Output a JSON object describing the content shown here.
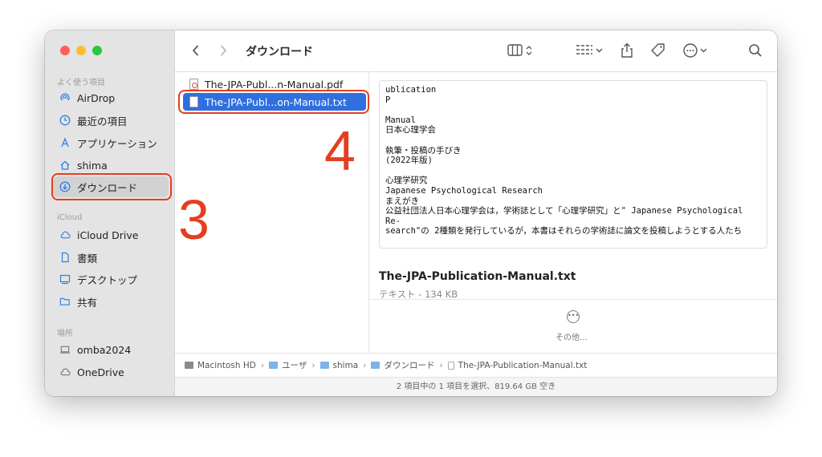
{
  "sidebar": {
    "favorites_label": "よく使う項目",
    "favorites": [
      {
        "label": "AirDrop",
        "icon": "airdrop-icon"
      },
      {
        "label": "最近の項目",
        "icon": "clock-icon"
      },
      {
        "label": "アプリケーション",
        "icon": "applications-icon"
      },
      {
        "label": "shima",
        "icon": "home-icon"
      },
      {
        "label": "ダウンロード",
        "icon": "download-icon"
      }
    ],
    "icloud_label": "iCloud",
    "icloud": [
      {
        "label": "iCloud Drive",
        "icon": "cloud-icon"
      },
      {
        "label": "書類",
        "icon": "document-icon"
      },
      {
        "label": "デスクトップ",
        "icon": "desktop-icon"
      },
      {
        "label": "共有",
        "icon": "shared-folder-icon"
      }
    ],
    "locations_label": "場所",
    "locations": [
      {
        "label": "omba2024",
        "icon": "laptop-icon"
      },
      {
        "label": "OneDrive",
        "icon": "cloud-icon"
      }
    ]
  },
  "toolbar": {
    "title": "ダウンロード"
  },
  "files": [
    {
      "name": "The-JPA-Publ...n-Manual.pdf",
      "type": "pdf"
    },
    {
      "name": "The-JPA-Publ...on-Manual.txt",
      "type": "txt"
    }
  ],
  "preview": {
    "content": "ublication\nP\n\nManual\n日本心理学会\n\n執筆・投稿の手びき\n(2022年版)\n\n心理学研究\nJapanese Psychological Research\nまえがき\n公益社団法人日本心理学会は，学術誌として「心理学研究」と\" Japanese Psychological\nRe-\nsearch\"の 2種類を発行しているが，本書はそれらの学術誌に論文を投稿しようとする人たち",
    "filename": "The-JPA-Publication-Manual.txt",
    "meta": "テキスト - 134 KB",
    "more_label": "その他..."
  },
  "pathbar": [
    "Macintosh HD",
    "ユーザ",
    "shima",
    "ダウンロード",
    "The-JPA-Publication-Manual.txt"
  ],
  "status": "2 項目中の 1 項目を選択、819.64 GB 空き",
  "annotations": [
    "3",
    "4"
  ]
}
